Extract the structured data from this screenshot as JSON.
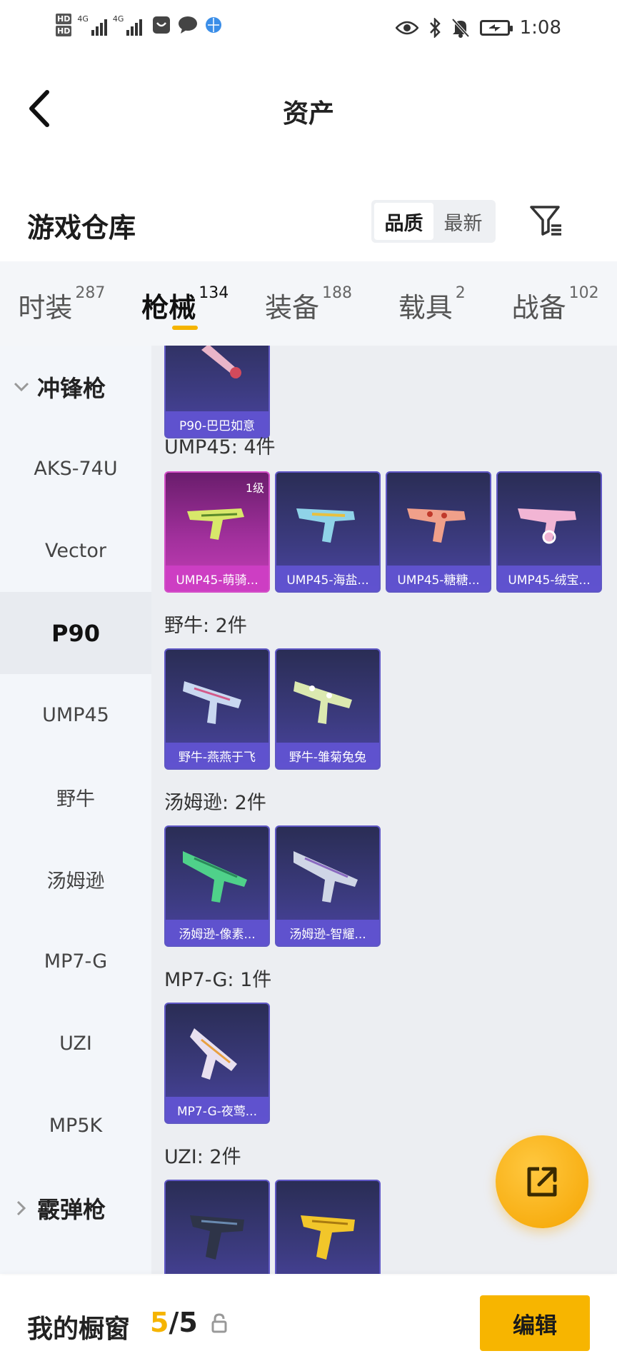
{
  "status_bar": {
    "hd1": "HD",
    "hd2": "HD",
    "net1": "4G",
    "net2": "4G",
    "time": "1:08",
    "icons": [
      "eye-icon",
      "bluetooth-icon",
      "bell-off-icon",
      "battery-charging-icon"
    ]
  },
  "header": {
    "title": "资产"
  },
  "section": {
    "title": "游戏仓库",
    "sort_options": [
      "品质",
      "最新"
    ],
    "active_sort": "品质"
  },
  "tabs": [
    {
      "label": "时装",
      "count": "287"
    },
    {
      "label": "枪械",
      "count": "134",
      "active": true
    },
    {
      "label": "装备",
      "count": "188"
    },
    {
      "label": "载具",
      "count": "2"
    },
    {
      "label": "战备",
      "count": "102"
    }
  ],
  "sidebar": {
    "group1": "冲锋枪",
    "items": [
      "AKS-74U",
      "Vector",
      "P90",
      "UMP45",
      "野牛",
      "汤姆逊",
      "MP7-G",
      "UZI",
      "MP5K"
    ],
    "active_item": "P90",
    "group2": "霰弹枪"
  },
  "content": {
    "top_card": "P90-巴巴如意",
    "groups": [
      {
        "label": "UMP45: 4件",
        "cards": [
          {
            "name": "UMP45-萌骑...",
            "level": "1级",
            "rarity": "pink"
          },
          {
            "name": "UMP45-海盐..."
          },
          {
            "name": "UMP45-糖糖..."
          },
          {
            "name": "UMP45-绒宝..."
          }
        ]
      },
      {
        "label": "野牛: 2件",
        "cards": [
          {
            "name": "野牛-燕燕于飞"
          },
          {
            "name": "野牛-雏菊兔兔"
          }
        ]
      },
      {
        "label": "汤姆逊: 2件",
        "cards": [
          {
            "name": "汤姆逊-像素..."
          },
          {
            "name": "汤姆逊-智耀..."
          }
        ]
      },
      {
        "label": "MP7-G: 1件",
        "cards": [
          {
            "name": "MP7-G-夜莺..."
          }
        ]
      },
      {
        "label": "UZI: 2件",
        "cards": [
          {
            "name": ""
          },
          {
            "name": ""
          }
        ]
      }
    ]
  },
  "bottom_bar": {
    "label": "我的橱窗",
    "current": "5",
    "separator": "/",
    "total": "5",
    "edit_label": "编辑"
  },
  "colors": {
    "accent": "#f5b400",
    "card_blue": "#3c3b80",
    "card_pink": "#c53fb7"
  }
}
